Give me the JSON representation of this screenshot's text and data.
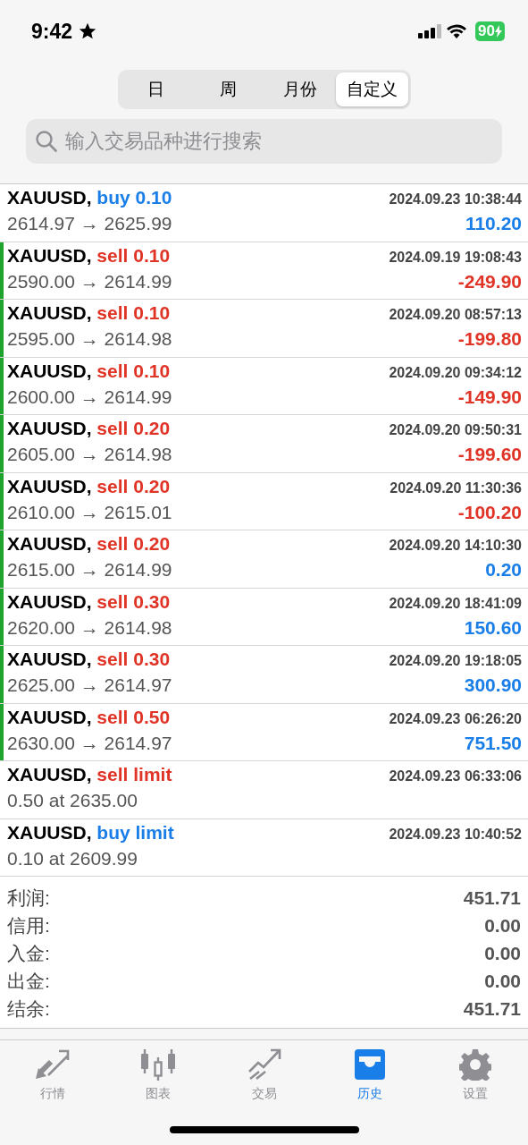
{
  "status_bar": {
    "time": "9:42",
    "battery": "90"
  },
  "periods": [
    {
      "label": "日",
      "selected": false
    },
    {
      "label": "周",
      "selected": false
    },
    {
      "label": "月份",
      "selected": false
    },
    {
      "label": "自定义",
      "selected": true
    }
  ],
  "search": {
    "placeholder": "输入交易品种进行搜索"
  },
  "rows": [
    {
      "kind": "deal",
      "symbol": "XAUUSD,",
      "is_buy": true,
      "action": "buy 0.10",
      "prices": "2614.97 → 2625.99",
      "time": "2024.09.23 10:38:44",
      "profit": "110.20",
      "loss": false,
      "flagged": false
    },
    {
      "kind": "deal",
      "symbol": "XAUUSD,",
      "is_buy": false,
      "action": "sell 0.10",
      "prices": "2590.00 → 2614.99",
      "time": "2024.09.19 19:08:43",
      "profit": "-249.90",
      "loss": true,
      "flagged": true
    },
    {
      "kind": "deal",
      "symbol": "XAUUSD,",
      "is_buy": false,
      "action": "sell 0.10",
      "prices": "2595.00 → 2614.98",
      "time": "2024.09.20 08:57:13",
      "profit": "-199.80",
      "loss": true,
      "flagged": true
    },
    {
      "kind": "deal",
      "symbol": "XAUUSD,",
      "is_buy": false,
      "action": "sell 0.10",
      "prices": "2600.00 → 2614.99",
      "time": "2024.09.20 09:34:12",
      "profit": "-149.90",
      "loss": true,
      "flagged": true
    },
    {
      "kind": "deal",
      "symbol": "XAUUSD,",
      "is_buy": false,
      "action": "sell 0.20",
      "prices": "2605.00 → 2614.98",
      "time": "2024.09.20 09:50:31",
      "profit": "-199.60",
      "loss": true,
      "flagged": true
    },
    {
      "kind": "deal",
      "symbol": "XAUUSD,",
      "is_buy": false,
      "action": "sell 0.20",
      "prices": "2610.00 → 2615.01",
      "time": "2024.09.20 11:30:36",
      "profit": "-100.20",
      "loss": true,
      "flagged": true
    },
    {
      "kind": "deal",
      "symbol": "XAUUSD,",
      "is_buy": false,
      "action": "sell 0.20",
      "prices": "2615.00 → 2614.99",
      "time": "2024.09.20 14:10:30",
      "profit": "0.20",
      "loss": false,
      "flagged": true
    },
    {
      "kind": "deal",
      "symbol": "XAUUSD,",
      "is_buy": false,
      "action": "sell 0.30",
      "prices": "2620.00 → 2614.98",
      "time": "2024.09.20 18:41:09",
      "profit": "150.60",
      "loss": false,
      "flagged": true
    },
    {
      "kind": "deal",
      "symbol": "XAUUSD,",
      "is_buy": false,
      "action": "sell 0.30",
      "prices": "2625.00 → 2614.97",
      "time": "2024.09.20 19:18:05",
      "profit": "300.90",
      "loss": false,
      "flagged": true
    },
    {
      "kind": "deal",
      "symbol": "XAUUSD,",
      "is_buy": false,
      "action": "sell 0.50",
      "prices": "2630.00 → 2614.97",
      "time": "2024.09.23 06:26:20",
      "profit": "751.50",
      "loss": false,
      "flagged": true
    },
    {
      "kind": "order",
      "symbol": "XAUUSD,",
      "is_buy": false,
      "action": "sell limit",
      "prices": "0.50 at 2635.00",
      "time": "2024.09.23 06:33:06",
      "flagged": false
    },
    {
      "kind": "order",
      "symbol": "XAUUSD,",
      "is_buy": true,
      "action": "buy limit",
      "prices": "0.10 at 2609.99",
      "time": "2024.09.23 10:40:52",
      "flagged": false
    }
  ],
  "summary": [
    {
      "label": "利润:",
      "value": "451.71"
    },
    {
      "label": "信用:",
      "value": "0.00"
    },
    {
      "label": "入金:",
      "value": "0.00"
    },
    {
      "label": "出金:",
      "value": "0.00"
    },
    {
      "label": "结余:",
      "value": "451.71"
    }
  ],
  "tabs": [
    {
      "label": "行情",
      "selected": false
    },
    {
      "label": "图表",
      "selected": false
    },
    {
      "label": "交易",
      "selected": false
    },
    {
      "label": "历史",
      "selected": true
    },
    {
      "label": "设置",
      "selected": false
    }
  ]
}
